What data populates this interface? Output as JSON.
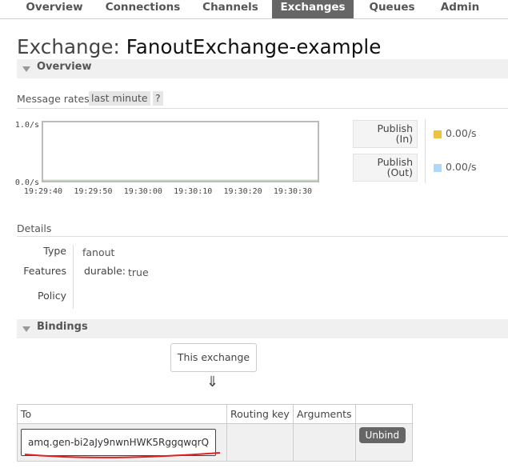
{
  "nav": {
    "tabs": [
      {
        "label": "Overview"
      },
      {
        "label": "Connections"
      },
      {
        "label": "Channels"
      },
      {
        "label": "Exchanges",
        "active": true
      },
      {
        "label": "Queues"
      },
      {
        "label": "Admin"
      }
    ]
  },
  "page": {
    "title_prefix": "Exchange:",
    "title_name": "FanoutExchange-example"
  },
  "overview": {
    "section_title": "Overview",
    "rates_label": "Message rates",
    "range_chip": "last minute",
    "help_chip": "?"
  },
  "chart_data": {
    "type": "line",
    "y_ticks": [
      "1.0/s",
      "0.0/s"
    ],
    "ylim": [
      0,
      1
    ],
    "x_ticks": [
      "19:29:40",
      "19:29:50",
      "19:30:00",
      "19:30:10",
      "19:30:20",
      "19:30:30"
    ],
    "series": [
      {
        "name": "Publish (In)",
        "values": [
          0,
          0,
          0,
          0,
          0,
          0
        ],
        "color": "#edc240"
      },
      {
        "name": "Publish (Out)",
        "values": [
          0,
          0,
          0,
          0,
          0,
          0
        ],
        "color": "#afd8f8"
      }
    ]
  },
  "legend": [
    {
      "label_line1": "Publish",
      "label_line2": "(In)",
      "value": "0.00/s",
      "color": "#edc240"
    },
    {
      "label_line1": "Publish",
      "label_line2": "(Out)",
      "value": "0.00/s",
      "color": "#afd8f8"
    }
  ],
  "details": {
    "label": "Details",
    "type_key": "Type",
    "type_value": "fanout",
    "features_key": "Features",
    "features_sub_key": "durable:",
    "features_sub_value": "true",
    "policy_key": "Policy",
    "policy_value": ""
  },
  "bindings": {
    "section_title": "Bindings",
    "this_exchange": "This exchange",
    "arrow": "⇓",
    "columns": [
      "To",
      "Routing key",
      "Arguments",
      ""
    ],
    "rows": [
      {
        "to": "amq.gen-bi2aJy9nwnHWK5RggqwqrQ",
        "routing_key": "",
        "arguments": "",
        "action": "Unbind"
      }
    ]
  }
}
